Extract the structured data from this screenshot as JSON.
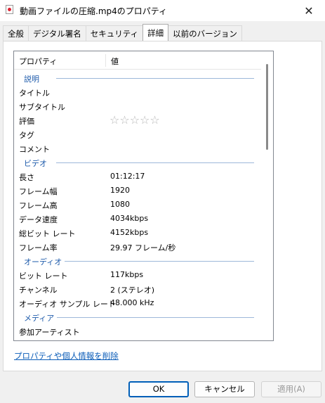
{
  "window": {
    "title": "動画ファイルの圧縮.mp4のプロパティ",
    "close_glyph": "✕"
  },
  "tabs": [
    {
      "label": "全般"
    },
    {
      "label": "デジタル署名"
    },
    {
      "label": "セキュリティ"
    },
    {
      "label": "詳細",
      "active": true
    },
    {
      "label": "以前のバージョン"
    }
  ],
  "table": {
    "header": {
      "property": "プロパティ",
      "value": "値"
    },
    "groups": {
      "description": "説明",
      "video": "ビデオ",
      "audio": "オーディオ",
      "media": "メディア"
    },
    "description_rows": [
      {
        "key": "タイトル",
        "value": ""
      },
      {
        "key": "サブタイトル",
        "value": ""
      },
      {
        "key": "評価",
        "value": ""
      },
      {
        "key": "タグ",
        "value": ""
      },
      {
        "key": "コメント",
        "value": ""
      }
    ],
    "rating_stars": "☆☆☆☆☆",
    "video_rows": [
      {
        "key": "長さ",
        "value": "01:12:17"
      },
      {
        "key": "フレーム幅",
        "value": "1920"
      },
      {
        "key": "フレーム高",
        "value": "1080"
      },
      {
        "key": "データ速度",
        "value": "4034kbps"
      },
      {
        "key": "総ビット レート",
        "value": "4152kbps"
      },
      {
        "key": "フレーム率",
        "value": "29.97 フレーム/秒"
      }
    ],
    "audio_rows": [
      {
        "key": "ビット レート",
        "value": "117kbps"
      },
      {
        "key": "チャンネル",
        "value": "2 (ステレオ)"
      },
      {
        "key": "オーディオ サンプル レート",
        "value": "48.000 kHz"
      }
    ],
    "media_rows": [
      {
        "key": "参加アーティスト",
        "value": ""
      }
    ]
  },
  "links": {
    "remove_properties": "プロパティや個人情報を削除"
  },
  "buttons": {
    "ok": "OK",
    "cancel": "キャンセル",
    "apply": "適用(A)"
  }
}
